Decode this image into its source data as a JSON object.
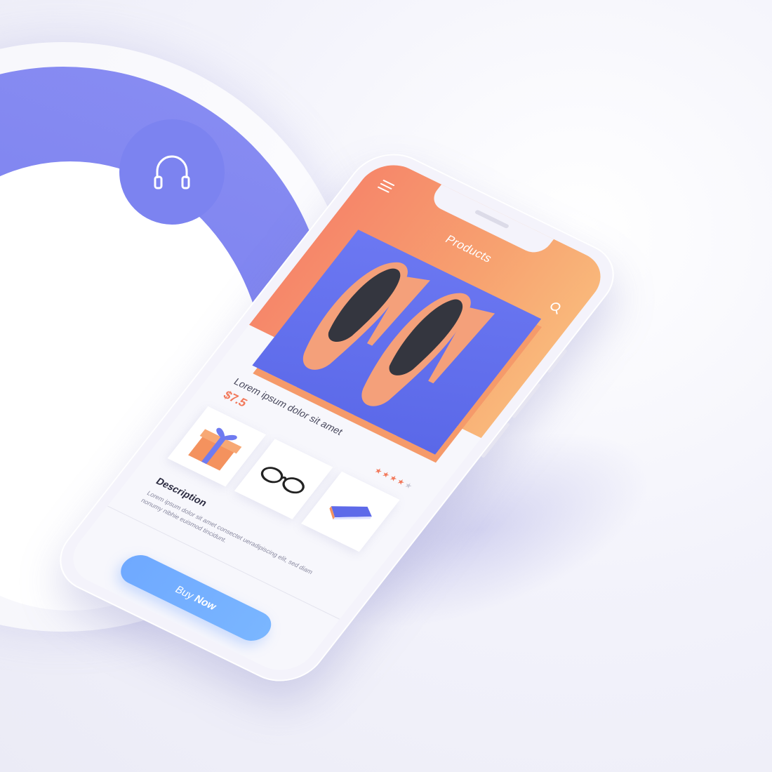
{
  "app": {
    "title": "Products"
  },
  "product": {
    "name": "Lorem ipsum dolor sit amet",
    "price": "$7.5",
    "rating": {
      "value": 3.5,
      "max": 5
    }
  },
  "thumbnails": [
    {
      "icon": "gift-box-icon"
    },
    {
      "icon": "glasses-icon"
    },
    {
      "icon": "book-icon"
    }
  ],
  "description": {
    "title": "Description",
    "text": "Lorem ipsum dolor sit amet consectet ueradipiscing elit, sed diam nonumy nibhie euismod tincidunt."
  },
  "buy_button": {
    "label_prefix": "Buy",
    "label_strong": "Now"
  },
  "colors": {
    "header": "#f7a270",
    "accent": "#f2785a",
    "card": "#5a68e8",
    "button": "#7ab6ff",
    "ring": "#7c83f0"
  },
  "icons": {
    "background": "headphones-icon",
    "menu": "hamburger-menu-icon",
    "search": "search-icon"
  }
}
